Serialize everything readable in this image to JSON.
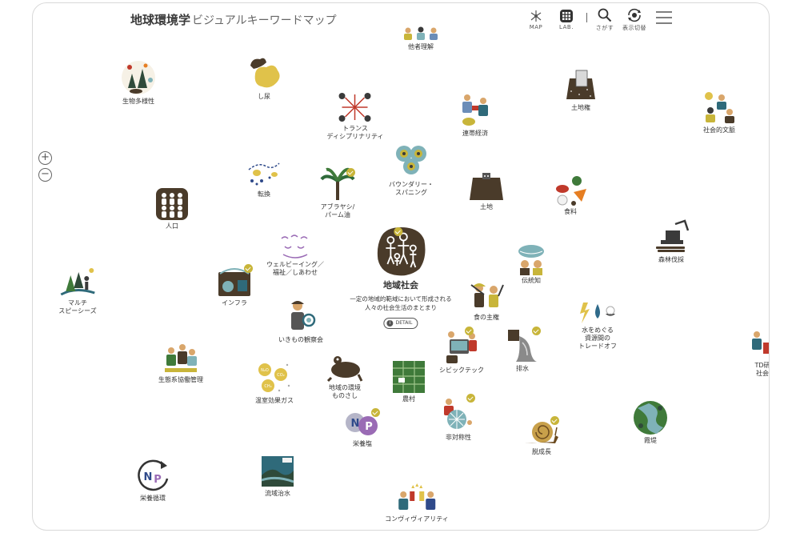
{
  "header": {
    "title_main": "地球環境学",
    "title_sub": "ビジュアルキーワードマップ",
    "nav": {
      "map": "MAP",
      "lab": "LAB.",
      "search": "さがす",
      "display": "表示切替"
    }
  },
  "zoom": {
    "plus": "+",
    "minus": "−"
  },
  "center": {
    "label": "地域社会",
    "description": "一定の地域的範域において形成される\n人々の社会生活のまとまり",
    "detail": "DETAIL"
  },
  "keywords": {
    "tashairikai": "他者理解",
    "seibutsu": "生物多様性",
    "shinyo": "し尿",
    "transdisciplinarity": "トランス\nディシプリナリティ",
    "rentai": "連帯経済",
    "tochiken": "土地権",
    "shakaibunmyaku": "社会的文脈",
    "tenkan": "転換",
    "aburayashi": "アブラヤシ/\nパーム油",
    "boundary": "バウンダリー・\nスパニング",
    "tochi": "土地",
    "shokuryo": "食料",
    "jinko": "人口",
    "wellbeing": "ウェルビーイング／\n福祉／しあわせ",
    "shinrin": "森林伐採",
    "denshochi": "伝統知",
    "multispecies": "マルチ\nスピーシーズ",
    "infra": "インフラ",
    "ikimono": "いきもの観察会",
    "shokunoshuken": "食の主権",
    "mizu": "水をめぐる\n資源間の\nトレードオフ",
    "seitaikei": "生態系協働管理",
    "onshitsu": "温室効果ガス",
    "chiikikankyo": "地域の環境\nものさし",
    "noson": "農村",
    "civictech": "シビックテック",
    "haisui": "排水",
    "td": "TD研\n社会",
    "eiyoen": "栄養塩",
    "taishosei": "非対称性",
    "kasumitei": "霞堤",
    "datsuseicho": "脱成長",
    "eiyojunkan": "栄養循環",
    "ryuiki": "流域治水",
    "convivial": "コンヴィヴィアリティ"
  },
  "icon_chars": {
    "np": "NP",
    "n2o": "N₂O",
    "co2": "CO₂",
    "ch4": "CH₄"
  },
  "colors": {
    "dark_brown": "#4a3b2a",
    "olive": "#6b5a2e",
    "gold": "#c8b53a",
    "teal": "#7fb2b8",
    "green": "#3f7a3a",
    "purple": "#9a6bb5"
  }
}
